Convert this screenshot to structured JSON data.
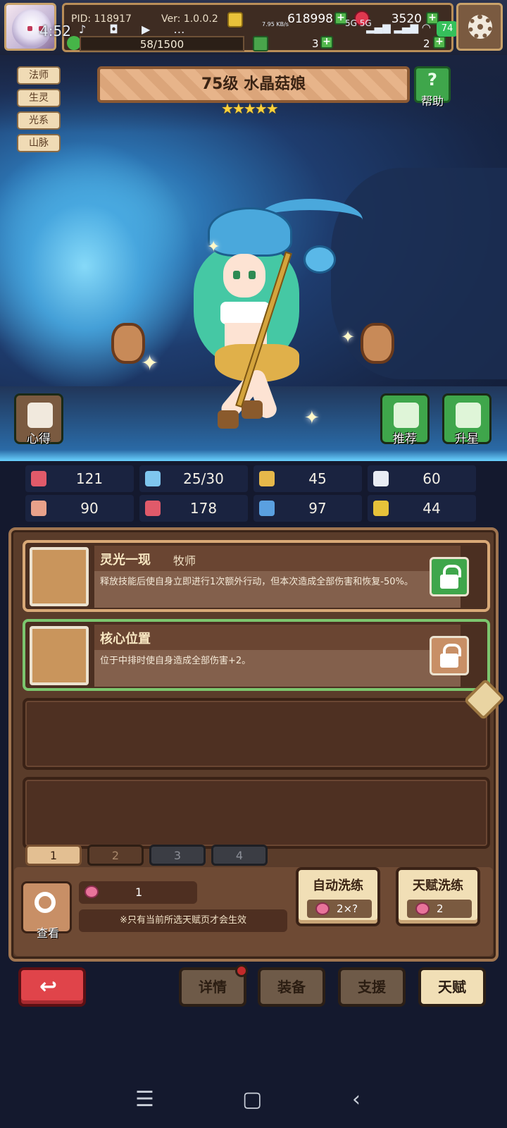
{
  "status": {
    "time": "4:52",
    "net_speed": "7.95 KB/s",
    "network": "5G 5G",
    "battery": "74"
  },
  "resources": {
    "pid": "PID: 118917",
    "version": "Ver: 1.0.0.2",
    "gold": "618998",
    "gems": "3520",
    "stamina": "58/1500",
    "tickets": "3",
    "keys": "2"
  },
  "hero": {
    "tags": [
      "法师",
      "生灵",
      "光系",
      "山脉"
    ],
    "title": "75级 水晶菇娘",
    "stars": 5,
    "help_label": "帮助",
    "left_button": "心得",
    "recommend_button": "推荐",
    "upgrade_star_button": "升星"
  },
  "stats": [
    {
      "icon": "heart-icon",
      "value": "121",
      "color": "#e05a6a"
    },
    {
      "icon": "mana-drop-icon",
      "value": "25/30",
      "color": "#7fc6ee"
    },
    {
      "icon": "shield-icon",
      "value": "45",
      "color": "#e6b84a"
    },
    {
      "icon": "wing-icon",
      "value": "60",
      "color": "#e8ecf4"
    },
    {
      "icon": "fist-icon",
      "value": "90",
      "color": "#e8a18a"
    },
    {
      "icon": "book-icon",
      "value": "178",
      "color": "#e05a6a"
    },
    {
      "icon": "boot-icon",
      "value": "97",
      "color": "#5aa0e0"
    },
    {
      "icon": "horseshoe-icon",
      "value": "44",
      "color": "#e6c23a"
    }
  ],
  "talents": [
    {
      "name": "灵光一现",
      "class": "牧师",
      "desc": "释放技能后使自身立即进行1次额外行动，但本次造成全部伤害和恢复-50%。",
      "locked": true
    },
    {
      "name": "核心位置",
      "class": "",
      "desc": "位于中排时使自身造成全部伤害+2。",
      "locked": false
    }
  ],
  "pages": [
    "1",
    "2",
    "3",
    "4"
  ],
  "bottom": {
    "view_label": "查看",
    "fruit_count": "1",
    "hint": "※只有当前所选天赋页才会生效",
    "auto_refine": {
      "label": "自动洗练",
      "cost": "2×?"
    },
    "talent_refine": {
      "label": "天赋洗练",
      "cost": "2"
    }
  },
  "nav": [
    "详情",
    "装备",
    "支援",
    "天赋"
  ],
  "colors": {
    "accent": "#d9a977",
    "active_border": "#7cc66e",
    "back": "#e0444a"
  }
}
